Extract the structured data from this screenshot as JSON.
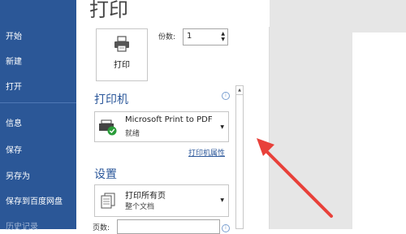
{
  "sidebar": {
    "items": [
      {
        "label": "开始"
      },
      {
        "label": "新建"
      },
      {
        "label": "打开"
      },
      {
        "label": "信息"
      },
      {
        "label": "保存"
      },
      {
        "label": "另存为"
      },
      {
        "label": "保存到百度网盘"
      },
      {
        "label": "历史记录"
      }
    ]
  },
  "main": {
    "title": "打印",
    "print_button_label": "打印",
    "copies_label": "份数:",
    "copies_value": "1",
    "printer_heading": "打印机",
    "printer_name": "Microsoft Print to PDF",
    "printer_status": "就绪",
    "printer_properties_link": "打印机属性",
    "settings_heading": "设置",
    "range_primary": "打印所有页",
    "range_secondary": "整个文档",
    "pages_label": "页数:"
  },
  "colors": {
    "sidebar_bg": "#2b5797",
    "accent": "#2b579a",
    "annotation_arrow": "#e8413a"
  },
  "icons": {
    "print_button": "printer-icon",
    "printer_dropdown": "printer-ready-icon",
    "settings_dropdown": "pages-icon",
    "info": "info-icon"
  }
}
